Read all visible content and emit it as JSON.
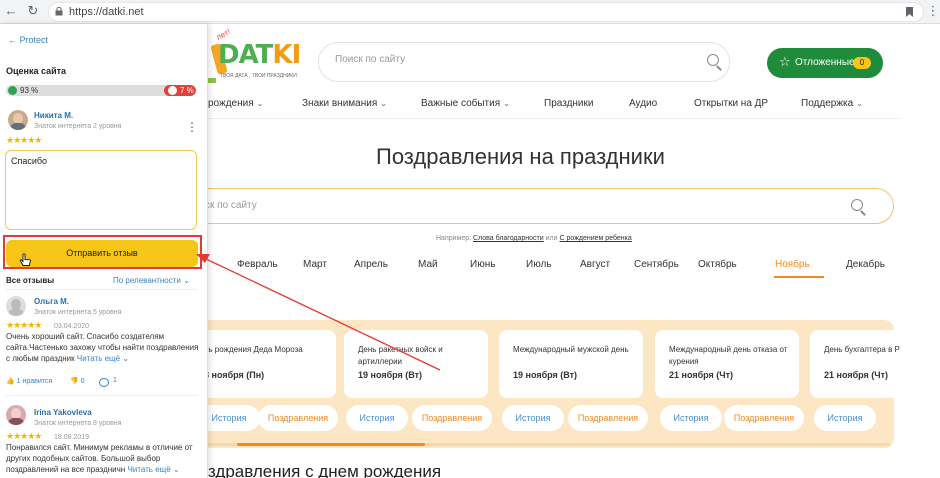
{
  "browser": {
    "url": "https://datki.net"
  },
  "site": {
    "logo": {
      "brand_part1": "DAT",
      "brand_part2": "KI",
      "tagline": "ТВОЯ ДАТА , ТВОИ ПРАЗДНИКИ",
      "badge": "лет!"
    },
    "search_placeholder": "Поиск по сайту",
    "saved_label": "Отложенные",
    "saved_count": "0",
    "nav": [
      "рождения",
      "Знаки внимания",
      "Важные события",
      "Праздники",
      "Аудио",
      "Открытки на ДР",
      "Поддержка"
    ],
    "page_title": "Поздравления на праздники",
    "big_search_placeholder": "ск по сайту",
    "hint": {
      "prefix": "Например: ",
      "link1": "Слова благодарности",
      "mid": " или ",
      "link2": "С рождением ребенка"
    },
    "months": [
      "Февраль",
      "Март",
      "Апрель",
      "Май",
      "Июнь",
      "Июль",
      "Август",
      "Сентябрь",
      "Октябрь",
      "Ноябрь",
      "Декабрь"
    ],
    "active_month": "Ноябрь",
    "holiday_cards": [
      {
        "name": "нь рождения Деда Мороза",
        "date": "8 ноября (Пн)"
      },
      {
        "name": "День ракетных войск и артиллерии",
        "date": "19 ноября (Вт)"
      },
      {
        "name": "Международный мужской день",
        "date": "19 ноября (Вт)"
      },
      {
        "name": "Международный день отказа от курения",
        "date": "21 ноября (Чт)"
      },
      {
        "name": "День бухгалтера в Р",
        "date": "21 ноября (Чт)"
      }
    ],
    "card_buttons": {
      "history": "История",
      "greetings": "Поздравления"
    },
    "next_section_title": "здравления с днем рождения"
  },
  "panel": {
    "back_label": "Protect",
    "title": "Оценка сайта",
    "positive_percent": "93 %",
    "negative_percent": "7 %",
    "positive_fraction": 0.93,
    "current_user": {
      "name": "Никита М.",
      "level": "Знаток интернета 2 уровня",
      "stars": "★★★★★"
    },
    "review_text": "Спасибо",
    "send_button": "Отправить отзыв",
    "all_reviews_label": "Все отзывы",
    "sort_label": "По релевантности",
    "reviews": [
      {
        "name": "Ольга М.",
        "level": "Знаток интернета 5 уровня",
        "stars": "★★★★★",
        "date": "03.04.2020",
        "text": "Очень хороший сайт. Спасибо создателям сайта.Частенько захожу чтобы найти поздравления с любым праздник",
        "more": "Читать ещё",
        "likes": "1 нравится",
        "dislikes": "0",
        "comments": "1"
      },
      {
        "name": "Irina Yakovleva",
        "level": "Знаток интернета 8 уровня",
        "stars": "★★★★★",
        "date": "18.08.2019",
        "text": "Понравился сайт. Минимум рекламы в отличие от других подобных сайтов. Большой выбор поздравлений на все праздничн",
        "more": "Читать ещё"
      }
    ]
  },
  "colors": {
    "accent_green": "#1e8c3a",
    "accent_orange": "#f18a1f",
    "yellow": "#f5c518",
    "link_blue": "#3b82c4",
    "highlight_red": "#e53935"
  }
}
